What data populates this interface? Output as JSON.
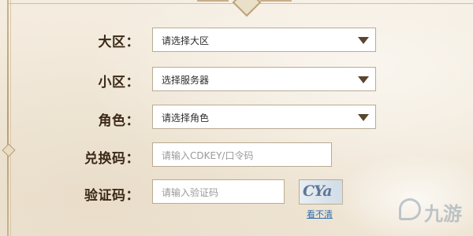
{
  "form": {
    "region": {
      "label": "大区：",
      "value": "请选择大区"
    },
    "server": {
      "label": "小区：",
      "value": "选择服务器"
    },
    "role": {
      "label": "角色：",
      "value": "请选择角色"
    },
    "code": {
      "label": "兑换码：",
      "placeholder": "请输入CDKEY/口令码"
    },
    "captcha": {
      "label": "验证码：",
      "placeholder": "请输入验证码",
      "image_text": "CYa",
      "refresh_text": "看不清"
    }
  },
  "watermark": {
    "text": "九游"
  },
  "colors": {
    "background": "#f1e9da",
    "label": "#3b2a17",
    "arrow": "#5a4530",
    "link": "#2f6fb0"
  },
  "icons": {
    "dropdown": "triangle-down-icon",
    "watermark_logo": "jiuyou-logo-icon"
  }
}
